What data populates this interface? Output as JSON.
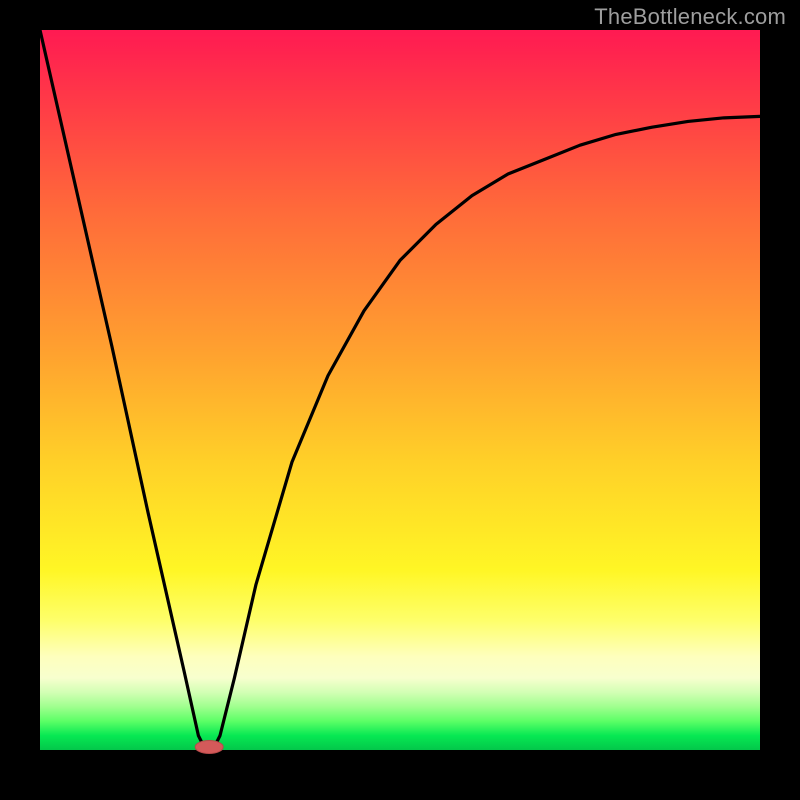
{
  "watermark": "TheBottleneck.com",
  "chart_data": {
    "type": "line",
    "title": "",
    "xlabel": "",
    "ylabel": "",
    "xlim": [
      0,
      100
    ],
    "ylim": [
      0,
      100
    ],
    "grid": false,
    "legend": false,
    "annotations": [],
    "background_gradient": {
      "orientation": "vertical",
      "stops": [
        {
          "pos": 0,
          "color": "#ff1a52"
        },
        {
          "pos": 25,
          "color": "#ff6a3a"
        },
        {
          "pos": 50,
          "color": "#ffbe2a"
        },
        {
          "pos": 75,
          "color": "#fff625"
        },
        {
          "pos": 90,
          "color": "#f7ffce"
        },
        {
          "pos": 100,
          "color": "#03c74a"
        }
      ]
    },
    "series": [
      {
        "name": "bottleneck-curve",
        "x": [
          0,
          5,
          10,
          15,
          20,
          22,
          23,
          24,
          25,
          27,
          30,
          35,
          40,
          45,
          50,
          55,
          60,
          65,
          70,
          75,
          80,
          85,
          90,
          95,
          100
        ],
        "y": [
          100,
          78,
          56,
          33,
          11,
          2,
          0,
          0,
          2,
          10,
          23,
          40,
          52,
          61,
          68,
          73,
          77,
          80,
          82,
          84,
          85.5,
          86.5,
          87.3,
          87.8,
          88
        ]
      }
    ],
    "marker": {
      "name": "optimal-point",
      "x": 23.5,
      "y": 0,
      "shape": "pill",
      "color": "#d45a5a"
    }
  }
}
